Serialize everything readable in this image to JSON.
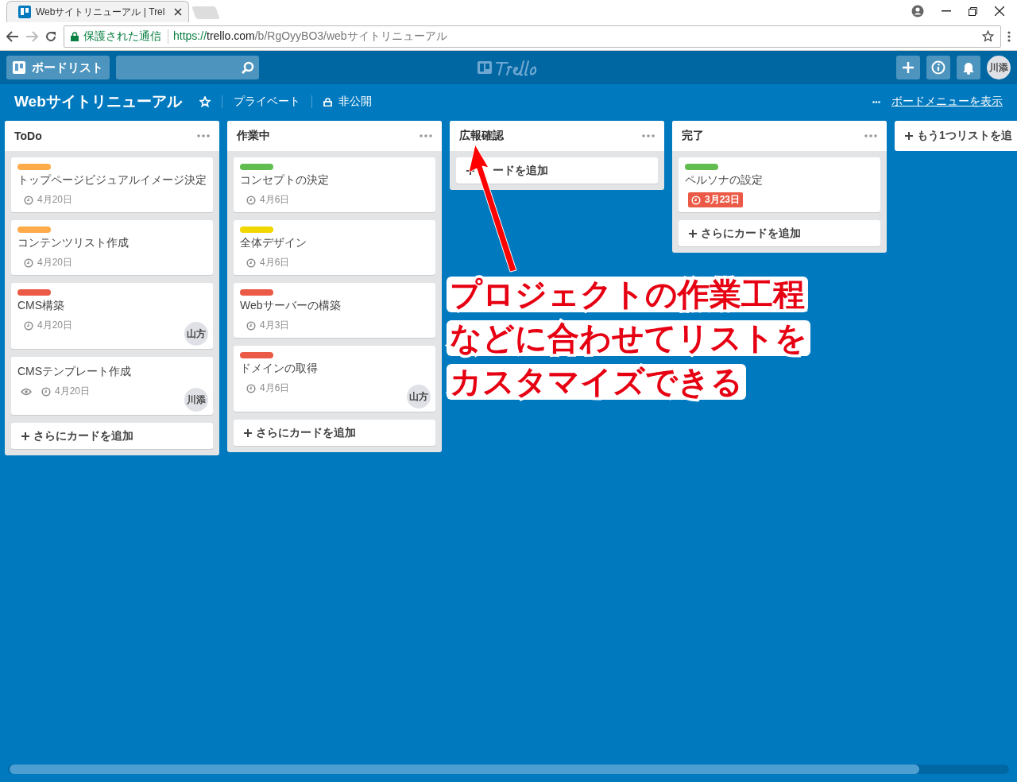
{
  "browser": {
    "tab_title": "Webサイトリニューアル | Trel",
    "secure_label": "保護された通信",
    "url_scheme": "https://",
    "url_host": "trello.com",
    "url_path": "/b/RgOyyBO3/webサイトリニューアル"
  },
  "header": {
    "boards_button": "ボードリスト",
    "avatar": "川添"
  },
  "board": {
    "title": "Webサイトリニューアル",
    "visibility": "プライベート",
    "privacy": "非公開",
    "menu_link": "ボードメニューを表示"
  },
  "lists": [
    {
      "title": "ToDo",
      "cards": [
        {
          "color": "#ffab4a",
          "title": "トップページビジュアルイメージ決定",
          "watching": false,
          "due": "4月20日",
          "due_overdue": false
        },
        {
          "color": "#ffab4a",
          "title": "コンテンツリスト作成",
          "watching": false,
          "due": "4月20日",
          "due_overdue": false
        },
        {
          "color": "#eb5a46",
          "title": "CMS構築",
          "watching": false,
          "due": "4月20日",
          "due_overdue": false,
          "member": "山方"
        },
        {
          "title": "CMSテンプレート作成",
          "watching": true,
          "due": "4月20日",
          "due_overdue": false,
          "member": "川添"
        }
      ],
      "add_card": "さらにカードを追加"
    },
    {
      "title": "作業中",
      "cards": [
        {
          "color": "#61bd4f",
          "title": "コンセプトの決定",
          "watching": false,
          "due": "4月6日",
          "due_overdue": false
        },
        {
          "color": "#f2d600",
          "title": "全体デザイン",
          "watching": false,
          "due": "4月6日",
          "due_overdue": false
        },
        {
          "color": "#eb5a46",
          "title": "Webサーバーの構築",
          "watching": false,
          "due": "4月3日",
          "due_overdue": false
        },
        {
          "color": "#eb5a46",
          "title": "ドメインの取得",
          "watching": false,
          "due": "4月6日",
          "due_overdue": false,
          "member": "山方"
        }
      ],
      "add_card": "さらにカードを追加"
    },
    {
      "title": "広報確認",
      "add_card": "ードを追加"
    },
    {
      "title": "完了",
      "cards": [
        {
          "color": "#61bd4f",
          "title": "ペルソナの設定",
          "watching": false,
          "due": "3月23日",
          "due_overdue": true
        }
      ],
      "add_card": "さらにカードを追加"
    }
  ],
  "add_list": "もう1つリストを追",
  "annotation": {
    "lines": [
      "プロジェクトの作業工程",
      "などに合わせてリストを",
      "カスタマイズできる"
    ]
  }
}
